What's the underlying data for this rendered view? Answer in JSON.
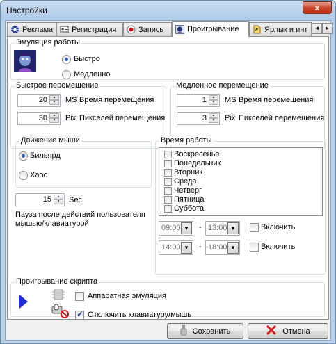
{
  "window": {
    "title": "Настройки",
    "close_glyph": "x"
  },
  "tabs": [
    {
      "label": "Реклама",
      "icon": "gear-flower-icon"
    },
    {
      "label": "Регистрация",
      "icon": "register-icon"
    },
    {
      "label": "Запись",
      "icon": "record-icon"
    },
    {
      "label": "Проигрывание",
      "icon": "play-icon",
      "active": true
    },
    {
      "label": "Ярлык и инт",
      "icon": "shortcut-icon"
    }
  ],
  "tab_scroll": {
    "left": "◄",
    "right": "►"
  },
  "emulation": {
    "title": "Эмуляция работы",
    "options": [
      "Быстро",
      "Медленно"
    ],
    "selected": "Быстро"
  },
  "fast_move": {
    "title": "Быстрое перемещение",
    "time": {
      "value": "20",
      "unit": "MS",
      "label": "Время перемещения"
    },
    "pixels": {
      "value": "30",
      "unit": "Pix",
      "label": "Пикселей перемещения"
    }
  },
  "slow_move": {
    "title": "Медленное перемещение",
    "time": {
      "value": "1",
      "unit": "MS",
      "label": "Время перемещения"
    },
    "pixels": {
      "value": "3",
      "unit": "Pix",
      "label": "Пикселей перемещения"
    }
  },
  "mouse_move": {
    "title": "Движение мыши",
    "options": [
      "Бильярд",
      "Хаос"
    ],
    "selected": "Бильярд"
  },
  "pause": {
    "value": "15",
    "unit": "Sec",
    "label_line1": "Пауза после действий пользователя",
    "label_line2": "мышью/клавиатурой"
  },
  "work_time": {
    "title": "Время работы",
    "days": [
      "Воскресенье",
      "Понедельник",
      "Вторник",
      "Среда",
      "Четверг",
      "Пятница",
      "Суббота"
    ],
    "range1": {
      "from": "09:00",
      "to": "13:00",
      "enable_label": "Включить"
    },
    "range2": {
      "from": "14:00",
      "to": "18:00",
      "enable_label": "Включить"
    },
    "dash": "-"
  },
  "script_play": {
    "title": "Проигрывание скрипта",
    "hardware_label": "Аппаратная эмуляция",
    "hardware_checked": false,
    "disable_input_label": "Отключить клавиатуру/мышь",
    "disable_input_checked": true
  },
  "buttons": {
    "save": "Сохранить",
    "cancel": "Отмена"
  },
  "colors": {
    "accent": "#2b59c3",
    "play_arrow": "#1c2fd6",
    "cancel_x": "#d21a1a"
  }
}
